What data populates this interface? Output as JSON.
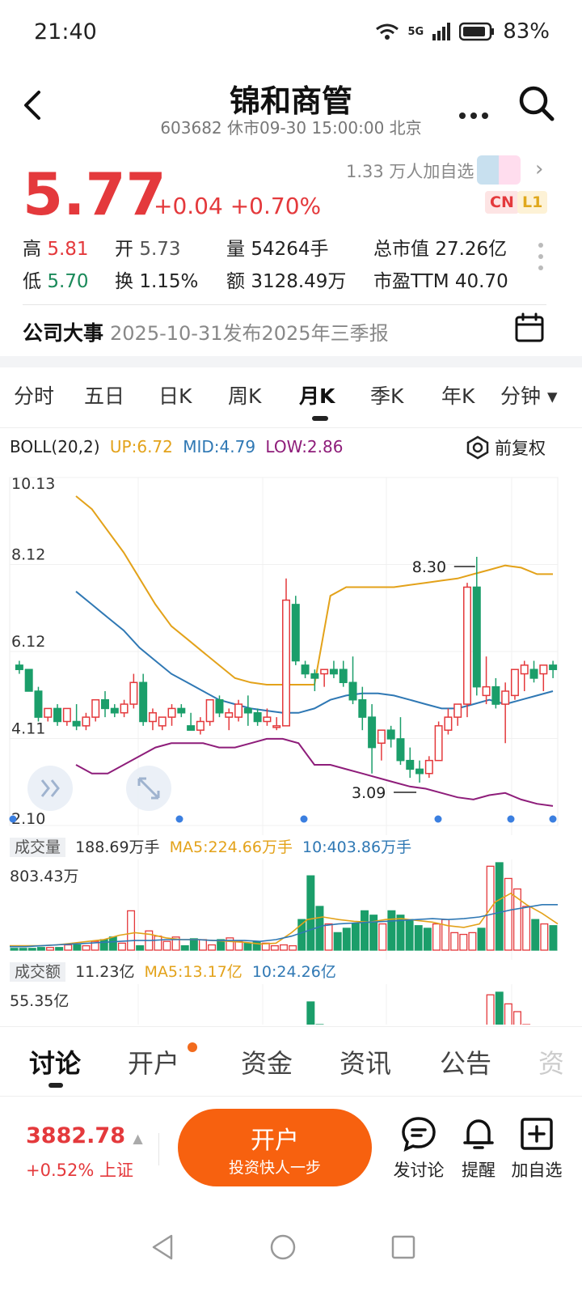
{
  "status_bar": {
    "time": "21:40",
    "network": "5G",
    "battery": "83%"
  },
  "header": {
    "title": "锦和商管",
    "subtitle": "603682 休市09-30 15:00:00 北京"
  },
  "quote": {
    "price": "5.77",
    "change": "+0.04 +0.70%",
    "followers": "1.33 万人加自选",
    "badge_cn": "CN",
    "badge_l1": "L1",
    "stats": {
      "high_label": "高",
      "high": "5.81",
      "open_label": "开",
      "open": "5.73",
      "vol_label": "量",
      "vol": "54264手",
      "mcap_label": "总市值",
      "mcap": "27.26亿",
      "low_label": "低",
      "low": "5.70",
      "turn_label": "换",
      "turn": "1.15%",
      "amt_label": "额",
      "amt": "3128.49万",
      "pe_label": "市盈TTM",
      "pe": "40.70"
    }
  },
  "event": {
    "label": "公司大事",
    "text": "2025-10-31发布2025年三季报"
  },
  "period_tabs": [
    "分时",
    "五日",
    "日K",
    "周K",
    "月K",
    "季K",
    "年K",
    "分钟 ▾"
  ],
  "active_tab": "月K",
  "indicator": {
    "name": "BOLL(20,2)",
    "up": "UP:6.72",
    "mid": "MID:4.79",
    "low": "LOW:2.86",
    "adjust": "前复权"
  },
  "volume_legend": {
    "label": "成交量",
    "value": "188.69万手",
    "ma5": "MA5:224.66万手",
    "ma10": "10:403.86万手",
    "max": "803.43万"
  },
  "amount_legend": {
    "label": "成交额",
    "value": "11.23亿",
    "ma5": "MA5:13.17亿",
    "ma10": "10:24.26亿",
    "max": "55.35亿"
  },
  "colors": {
    "up": "#e4393c",
    "down": "#1b9e6a",
    "boll_up": "#e3a21a",
    "boll_mid": "#2f78b4",
    "boll_low": "#8e1d7a",
    "accent": "#f7610f"
  },
  "chart_data": {
    "type": "candlestick",
    "y_ticks": [
      "10.13",
      "8.12",
      "6.12",
      "4.11",
      "2.10"
    ],
    "ylim": [
      2.1,
      10.13
    ],
    "high_mark": "8.30",
    "low_mark": "3.09",
    "candles": [
      [
        5.8,
        5.9,
        5.6,
        5.7
      ],
      [
        5.7,
        5.7,
        5.2,
        5.2
      ],
      [
        5.2,
        5.3,
        4.5,
        4.6
      ],
      [
        4.6,
        4.8,
        4.5,
        4.8
      ],
      [
        4.8,
        4.9,
        4.4,
        4.5
      ],
      [
        4.5,
        4.8,
        4.4,
        4.8
      ],
      [
        4.5,
        4.9,
        4.3,
        4.4
      ],
      [
        4.4,
        4.7,
        4.3,
        4.6
      ],
      [
        4.6,
        5.0,
        4.5,
        5.0
      ],
      [
        5.0,
        5.2,
        4.6,
        4.8
      ],
      [
        4.8,
        4.9,
        4.6,
        4.7
      ],
      [
        4.7,
        5.0,
        4.6,
        4.9
      ],
      [
        4.9,
        5.6,
        4.8,
        5.4
      ],
      [
        5.4,
        5.6,
        4.4,
        4.5
      ],
      [
        4.5,
        4.8,
        4.3,
        4.7
      ],
      [
        4.4,
        4.6,
        4.3,
        4.6
      ],
      [
        4.6,
        4.9,
        4.4,
        4.8
      ],
      [
        4.8,
        4.9,
        4.6,
        4.7
      ],
      [
        4.4,
        4.7,
        4.3,
        4.3
      ],
      [
        4.3,
        4.6,
        4.2,
        4.5
      ],
      [
        4.5,
        5.0,
        4.4,
        5.0
      ],
      [
        5.0,
        5.1,
        4.6,
        4.7
      ],
      [
        4.6,
        4.8,
        4.3,
        4.7
      ],
      [
        4.6,
        5.0,
        4.5,
        4.9
      ],
      [
        4.8,
        5.1,
        4.4,
        4.7
      ],
      [
        4.7,
        4.8,
        4.4,
        4.5
      ],
      [
        4.5,
        4.8,
        4.4,
        4.6
      ],
      [
        4.4,
        4.6,
        4.3,
        4.4
      ],
      [
        4.4,
        7.8,
        4.4,
        7.3
      ],
      [
        7.2,
        7.4,
        5.8,
        5.9
      ],
      [
        5.8,
        5.9,
        5.5,
        5.6
      ],
      [
        5.6,
        5.7,
        5.2,
        5.5
      ],
      [
        5.6,
        5.7,
        5.3,
        5.7
      ],
      [
        5.7,
        5.9,
        5.5,
        5.6
      ],
      [
        5.7,
        5.9,
        5.3,
        5.4
      ],
      [
        5.4,
        6.0,
        4.9,
        5.0
      ],
      [
        5.0,
        5.3,
        4.3,
        4.6
      ],
      [
        4.6,
        4.9,
        3.3,
        3.9
      ],
      [
        4.0,
        4.3,
        3.6,
        4.3
      ],
      [
        4.3,
        4.4,
        3.9,
        4.1
      ],
      [
        4.1,
        4.6,
        3.5,
        3.6
      ],
      [
        3.6,
        3.9,
        3.2,
        3.4
      ],
      [
        3.4,
        3.6,
        3.09,
        3.3
      ],
      [
        3.3,
        3.7,
        3.2,
        3.6
      ],
      [
        3.6,
        4.5,
        3.6,
        4.4
      ],
      [
        4.3,
        4.8,
        4.2,
        4.6
      ],
      [
        4.6,
        4.9,
        4.4,
        4.9
      ],
      [
        4.9,
        7.7,
        4.6,
        7.6
      ],
      [
        7.6,
        8.3,
        5.1,
        5.3
      ],
      [
        5.1,
        6.0,
        4.9,
        5.3
      ],
      [
        5.3,
        5.5,
        4.8,
        4.9
      ],
      [
        4.9,
        5.4,
        4.0,
        5.2
      ],
      [
        5.1,
        5.6,
        5.0,
        5.7
      ],
      [
        5.6,
        5.9,
        5.2,
        5.8
      ],
      [
        5.7,
        5.9,
        5.4,
        5.5
      ],
      [
        5.6,
        5.8,
        5.2,
        5.8
      ],
      [
        5.8,
        5.9,
        5.5,
        5.7
      ]
    ],
    "boll_up": [
      9.7,
      9.4,
      8.9,
      8.4,
      7.8,
      7.2,
      6.7,
      6.4,
      6.1,
      5.8,
      5.5,
      5.4,
      5.35,
      5.35,
      5.35,
      5.35,
      7.4,
      7.6,
      7.6,
      7.6,
      7.6,
      7.65,
      7.7,
      7.75,
      7.8,
      7.9,
      8.0,
      8.1,
      8.05,
      7.9,
      7.9
    ],
    "boll_mid": [
      7.5,
      7.2,
      6.9,
      6.6,
      6.2,
      5.9,
      5.6,
      5.4,
      5.2,
      5.0,
      4.9,
      4.8,
      4.75,
      4.7,
      4.7,
      4.8,
      5.0,
      5.1,
      5.15,
      5.15,
      5.1,
      5.0,
      4.9,
      4.8,
      4.8,
      4.9,
      5.0,
      4.9,
      5.0,
      5.1,
      5.2
    ],
    "boll_low": [
      3.5,
      3.3,
      3.3,
      3.5,
      3.7,
      3.9,
      4.0,
      4.0,
      4.0,
      3.9,
      3.9,
      4.0,
      4.1,
      4.1,
      4.0,
      3.5,
      3.5,
      3.4,
      3.3,
      3.2,
      3.1,
      3.0,
      2.95,
      2.85,
      2.75,
      2.7,
      2.8,
      2.85,
      2.7,
      2.6,
      2.55
    ],
    "volumes": [
      0.02,
      0.02,
      0.02,
      0.03,
      0.03,
      0.03,
      0.06,
      0.06,
      0.05,
      0.1,
      0.12,
      0.15,
      0.08,
      0.45,
      0.05,
      0.22,
      0.16,
      0.1,
      0.15,
      0.05,
      0.13,
      0.12,
      0.06,
      0.12,
      0.14,
      0.1,
      0.08,
      0.1,
      0.08,
      0.05,
      0.06,
      0.05,
      0.35,
      0.85,
      0.5,
      0.3,
      0.2,
      0.25,
      0.3,
      0.45,
      0.4,
      0.3,
      0.45,
      0.4,
      0.35,
      0.28,
      0.25,
      0.3,
      0.35,
      0.2,
      0.18,
      0.2,
      0.25,
      0.96,
      1.0,
      0.82,
      0.7,
      0.5,
      0.35,
      0.3,
      0.28
    ],
    "volume_ma5": [
      0.05,
      0.05,
      0.05,
      0.06,
      0.08,
      0.1,
      0.12,
      0.17,
      0.2,
      0.18,
      0.14,
      0.12,
      0.12,
      0.11,
      0.1,
      0.09,
      0.07,
      0.08,
      0.2,
      0.35,
      0.38,
      0.35,
      0.33,
      0.32,
      0.35,
      0.36,
      0.34,
      0.32,
      0.28,
      0.26,
      0.3,
      0.55,
      0.65,
      0.52,
      0.42,
      0.3
    ],
    "volume_ma10": [
      0.04,
      0.04,
      0.05,
      0.06,
      0.07,
      0.08,
      0.09,
      0.1,
      0.11,
      0.11,
      0.12,
      0.12,
      0.12,
      0.11,
      0.11,
      0.11,
      0.1,
      0.12,
      0.16,
      0.22,
      0.28,
      0.3,
      0.31,
      0.32,
      0.33,
      0.34,
      0.35,
      0.36,
      0.35,
      0.36,
      0.38,
      0.42,
      0.46,
      0.49,
      0.52,
      0.52
    ]
  },
  "bottom_tabs": [
    "讨论",
    "开户",
    "资金",
    "资讯",
    "公告",
    "资"
  ],
  "index": {
    "value": "3882.78",
    "change": "+0.52% 上证"
  },
  "open_button": {
    "title": "开户",
    "sub": "投资快人一步"
  },
  "actions": {
    "discuss": "发讨论",
    "alert": "提醒",
    "add": "加自选"
  }
}
